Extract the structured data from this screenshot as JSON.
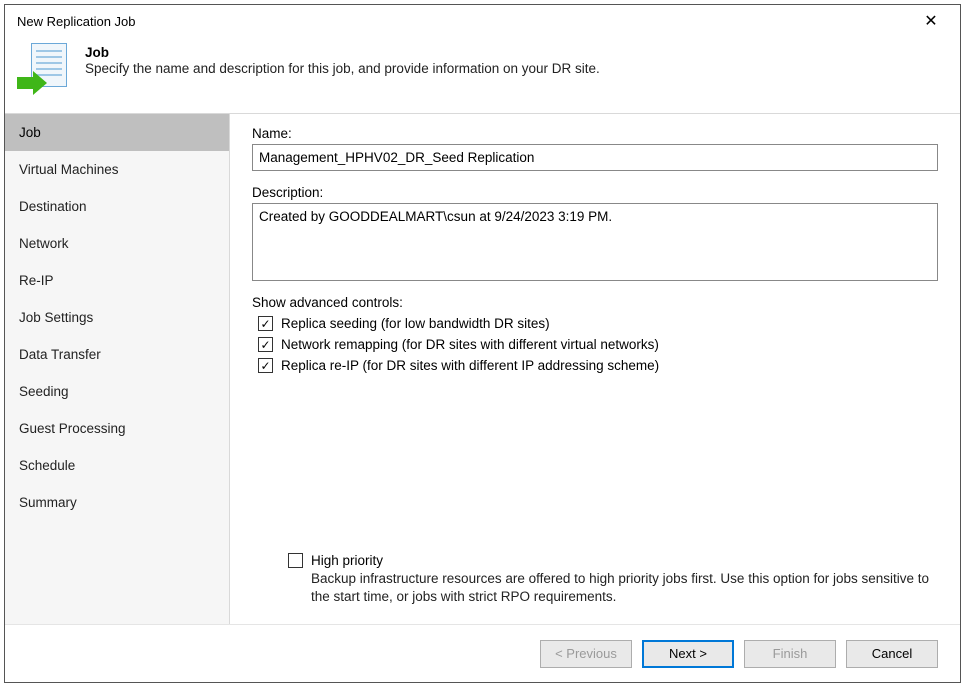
{
  "window": {
    "title": "New Replication Job",
    "close_glyph": "✕"
  },
  "header": {
    "title": "Job",
    "subtitle": "Specify the name and description for this job, and provide information on your DR site."
  },
  "sidebar": {
    "items": [
      {
        "label": "Job",
        "active": true
      },
      {
        "label": "Virtual Machines"
      },
      {
        "label": "Destination"
      },
      {
        "label": "Network"
      },
      {
        "label": "Re-IP"
      },
      {
        "label": "Job Settings"
      },
      {
        "label": "Data Transfer"
      },
      {
        "label": "Seeding"
      },
      {
        "label": "Guest Processing"
      },
      {
        "label": "Schedule"
      },
      {
        "label": "Summary"
      }
    ]
  },
  "form": {
    "name_label": "Name:",
    "name_value": "Management_HPHV02_DR_Seed Replication",
    "description_label": "Description:",
    "description_value": "Created by GOODDEALMART\\csun at 9/24/2023 3:19 PM.",
    "advanced_label": "Show advanced controls:",
    "advanced": [
      {
        "checked": true,
        "label": "Replica seeding (for low bandwidth DR sites)"
      },
      {
        "checked": true,
        "label": "Network remapping (for DR sites with different virtual networks)"
      },
      {
        "checked": true,
        "label": "Replica re-IP (for DR sites with different IP addressing scheme)"
      }
    ],
    "high_priority": {
      "checked": false,
      "label": "High priority",
      "description": "Backup infrastructure resources are offered to high priority jobs first. Use this option for jobs sensitive to the start time, or jobs with strict RPO requirements."
    }
  },
  "footer": {
    "previous": "< Previous",
    "next": "Next >",
    "finish": "Finish",
    "cancel": "Cancel"
  }
}
